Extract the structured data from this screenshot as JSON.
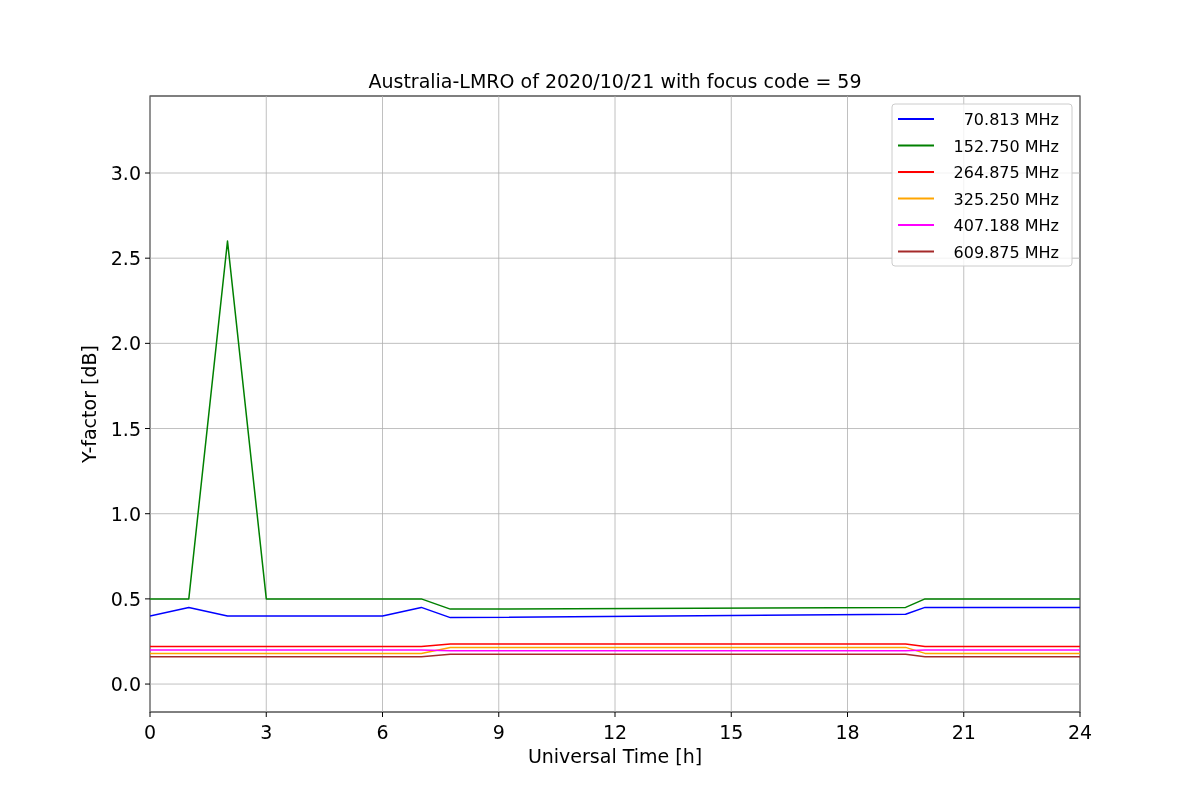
{
  "figure": {
    "chart_data": {
      "type": "line",
      "title": "Australia-LMRO of 2020/10/21 with focus code = 59",
      "xlabel": "Universal Time [h]",
      "ylabel": "Y-factor [dB]",
      "x": [
        0,
        1,
        2,
        3,
        4,
        5,
        6,
        7,
        7.75,
        19.5,
        20,
        21,
        22,
        23,
        24
      ],
      "series": [
        {
          "name": "70.813 MHz",
          "color": "#0000ff",
          "values": [
            0.4,
            0.45,
            0.4,
            0.4,
            0.4,
            0.4,
            0.4,
            0.45,
            0.39,
            0.41,
            0.45,
            0.45,
            0.45,
            0.45,
            0.45
          ]
        },
        {
          "name": "152.750 MHz",
          "color": "#008000",
          "values": [
            0.5,
            0.5,
            2.6,
            0.5,
            0.5,
            0.5,
            0.5,
            0.5,
            0.44,
            0.45,
            0.5,
            0.5,
            0.5,
            0.5,
            0.5
          ]
        },
        {
          "name": "264.875 MHz",
          "color": "#ff0000",
          "values": [
            0.22,
            0.22,
            0.22,
            0.22,
            0.22,
            0.22,
            0.22,
            0.22,
            0.235,
            0.235,
            0.22,
            0.22,
            0.22,
            0.22,
            0.22
          ]
        },
        {
          "name": "325.250 MHz",
          "color": "#ffa500",
          "values": [
            0.18,
            0.18,
            0.18,
            0.18,
            0.18,
            0.18,
            0.18,
            0.18,
            0.215,
            0.215,
            0.18,
            0.18,
            0.18,
            0.18,
            0.18
          ]
        },
        {
          "name": "407.188 MHz",
          "color": "#ff00ff",
          "values": [
            0.2,
            0.2,
            0.2,
            0.2,
            0.2,
            0.2,
            0.2,
            0.2,
            0.195,
            0.195,
            0.2,
            0.2,
            0.2,
            0.2,
            0.2
          ]
        },
        {
          "name": "609.875 MHz",
          "color": "#a52a2a",
          "values": [
            0.16,
            0.16,
            0.16,
            0.16,
            0.16,
            0.16,
            0.16,
            0.16,
            0.175,
            0.175,
            0.16,
            0.16,
            0.16,
            0.16,
            0.16
          ]
        }
      ],
      "grid": true,
      "legend": true,
      "xlim": [
        0,
        24
      ],
      "ylim": [
        -0.164,
        3.452
      ],
      "xticks": [
        0,
        3,
        6,
        9,
        12,
        15,
        18,
        21,
        24
      ],
      "yticks": [
        {
          "value": 0,
          "label": "0.0"
        },
        {
          "value": 0.5,
          "label": "0.5"
        },
        {
          "value": 1,
          "label": "1.0"
        },
        {
          "value": 1.5,
          "label": "1.5"
        },
        {
          "value": 2,
          "label": "2.0"
        },
        {
          "value": 2.5,
          "label": "2.5"
        },
        {
          "value": 3,
          "label": "3.0"
        }
      ]
    }
  }
}
